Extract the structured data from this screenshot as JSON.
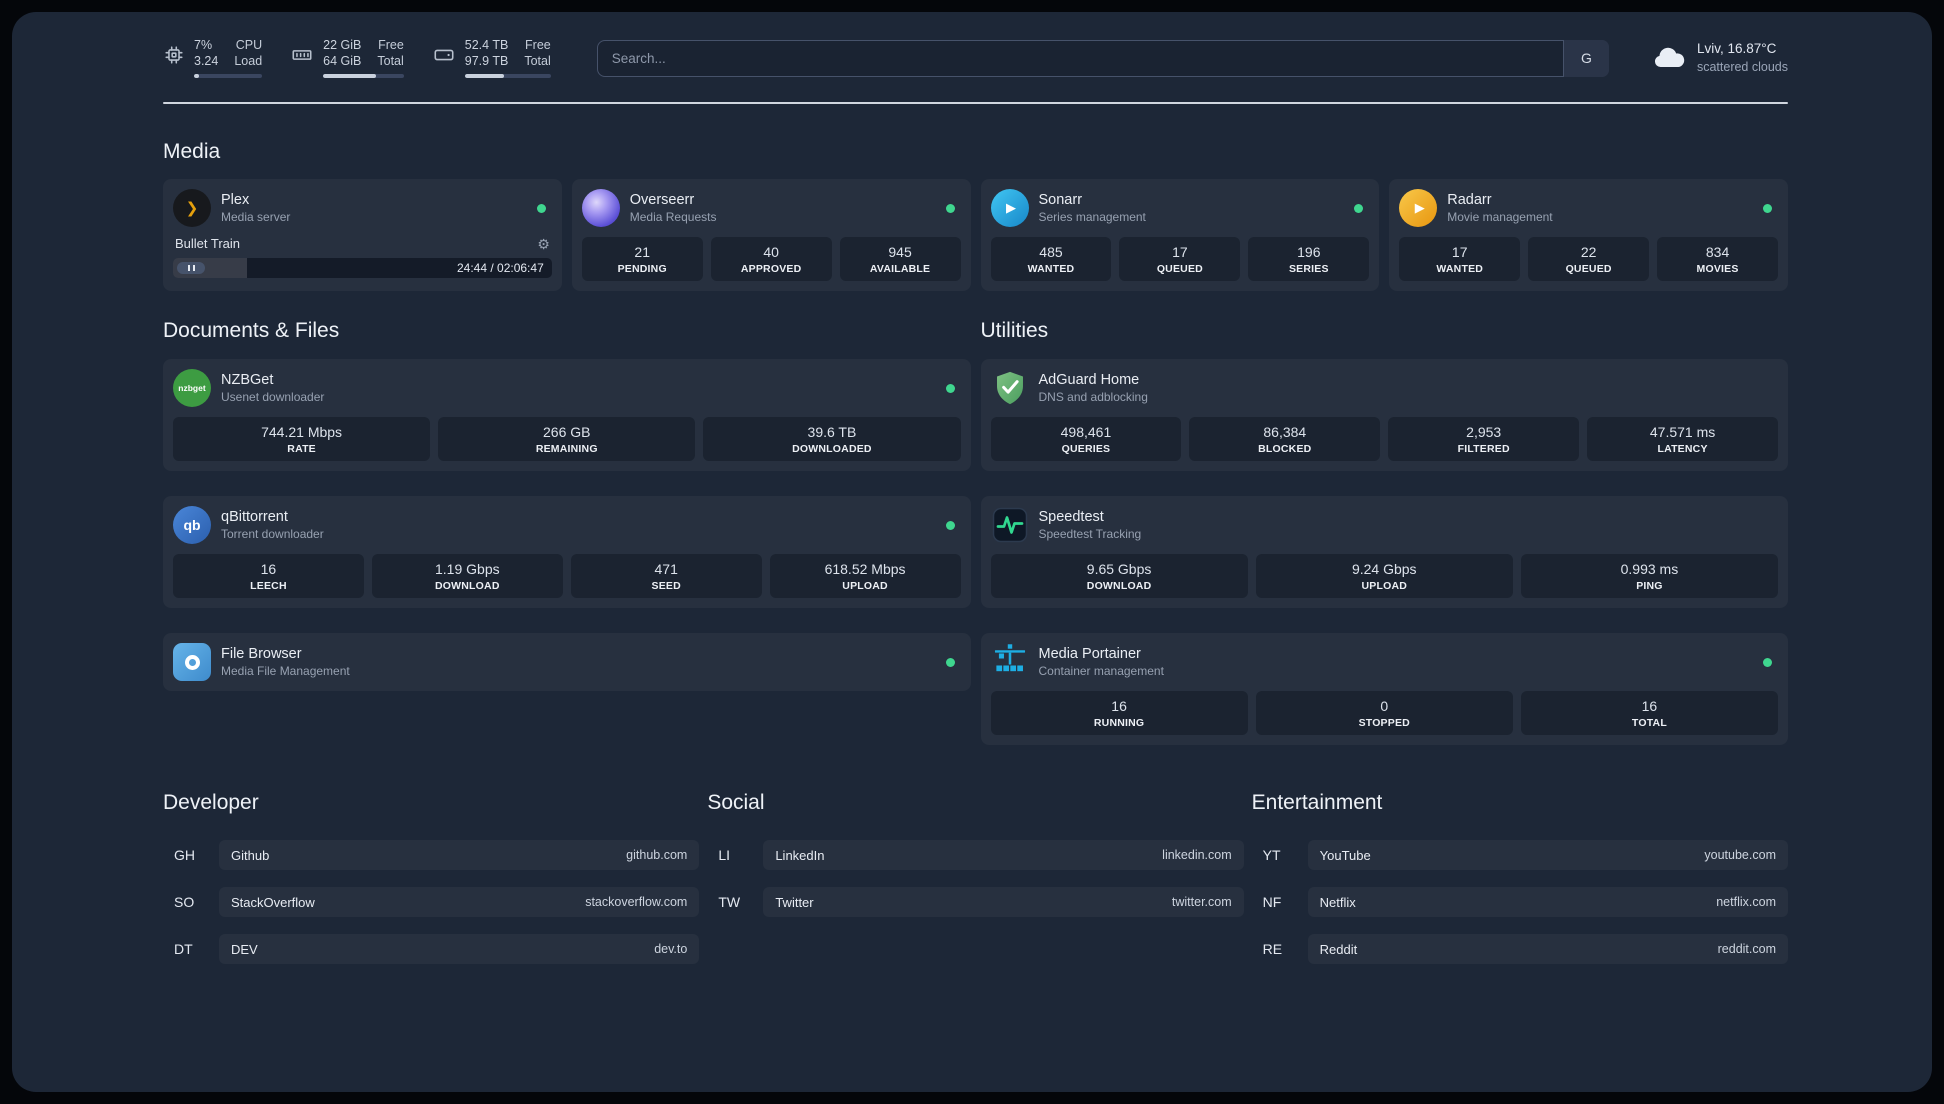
{
  "topbar": {
    "cpu": {
      "value1": "7%",
      "label1": "CPU",
      "value2": "3.24",
      "label2": "Load",
      "bar": 7
    },
    "memory": {
      "value1": "22 GiB",
      "label1": "Free",
      "value2": "64 GiB",
      "label2": "Total",
      "bar": 66
    },
    "disk": {
      "value1": "52.4 TB",
      "label1": "Free",
      "value2": "97.9 TB",
      "label2": "Total",
      "bar": 46
    },
    "search": {
      "placeholder": "Search...",
      "button": "G"
    },
    "weather": {
      "location": "Lviv, 16.87°C",
      "condition": "scattered clouds"
    }
  },
  "media": {
    "title": "Media",
    "cards": [
      {
        "name": "Plex",
        "subtitle": "Media server",
        "status": "online",
        "player": {
          "track": "Bullet Train",
          "time": "24:44 / 02:06:47",
          "progress_percent": 19.5
        }
      },
      {
        "name": "Overseerr",
        "subtitle": "Media Requests",
        "status": "online",
        "stats": [
          {
            "value": "21",
            "label": "PENDING"
          },
          {
            "value": "40",
            "label": "APPROVED"
          },
          {
            "value": "945",
            "label": "AVAILABLE"
          }
        ]
      },
      {
        "name": "Sonarr",
        "subtitle": "Series management",
        "status": "online",
        "stats": [
          {
            "value": "485",
            "label": "WANTED"
          },
          {
            "value": "17",
            "label": "QUEUED"
          },
          {
            "value": "196",
            "label": "SERIES"
          }
        ]
      },
      {
        "name": "Radarr",
        "subtitle": "Movie management",
        "status": "online",
        "stats": [
          {
            "value": "17",
            "label": "WANTED"
          },
          {
            "value": "22",
            "label": "QUEUED"
          },
          {
            "value": "834",
            "label": "MOVIES"
          }
        ]
      }
    ]
  },
  "documents": {
    "title": "Documents & Files",
    "cards": [
      {
        "name": "NZBGet",
        "subtitle": "Usenet downloader",
        "status": "online",
        "stats": [
          {
            "value": "744.21 Mbps",
            "label": "RATE"
          },
          {
            "value": "266 GB",
            "label": "REMAINING"
          },
          {
            "value": "39.6 TB",
            "label": "DOWNLOADED"
          }
        ]
      },
      {
        "name": "qBittorrent",
        "subtitle": "Torrent downloader",
        "status": "online",
        "stats": [
          {
            "value": "16",
            "label": "LEECH"
          },
          {
            "value": "1.19 Gbps",
            "label": "DOWNLOAD"
          },
          {
            "value": "471",
            "label": "SEED"
          },
          {
            "value": "618.52 Mbps",
            "label": "UPLOAD"
          }
        ]
      },
      {
        "name": "File Browser",
        "subtitle": "Media File Management",
        "status": "online"
      }
    ]
  },
  "utilities": {
    "title": "Utilities",
    "cards": [
      {
        "name": "AdGuard Home",
        "subtitle": "DNS and adblocking",
        "stats": [
          {
            "value": "498,461",
            "label": "QUERIES"
          },
          {
            "value": "86,384",
            "label": "BLOCKED"
          },
          {
            "value": "2,953",
            "label": "FILTERED"
          },
          {
            "value": "47.571 ms",
            "label": "LATENCY"
          }
        ]
      },
      {
        "name": "Speedtest",
        "subtitle": "Speedtest Tracking",
        "stats": [
          {
            "value": "9.65 Gbps",
            "label": "DOWNLOAD"
          },
          {
            "value": "9.24 Gbps",
            "label": "UPLOAD"
          },
          {
            "value": "0.993 ms",
            "label": "PING"
          }
        ]
      },
      {
        "name": "Media Portainer",
        "subtitle": "Container management",
        "status": "online",
        "stats": [
          {
            "value": "16",
            "label": "RUNNING"
          },
          {
            "value": "0",
            "label": "STOPPED"
          },
          {
            "value": "16",
            "label": "TOTAL"
          }
        ]
      }
    ]
  },
  "bookmarks": [
    {
      "title": "Developer",
      "items": [
        {
          "abbr": "GH",
          "name": "Github",
          "url": "github.com"
        },
        {
          "abbr": "SO",
          "name": "StackOverflow",
          "url": "stackoverflow.com"
        },
        {
          "abbr": "DT",
          "name": "DEV",
          "url": "dev.to"
        }
      ]
    },
    {
      "title": "Social",
      "items": [
        {
          "abbr": "LI",
          "name": "LinkedIn",
          "url": "linkedin.com"
        },
        {
          "abbr": "TW",
          "name": "Twitter",
          "url": "twitter.com"
        }
      ]
    },
    {
      "title": "Entertainment",
      "items": [
        {
          "abbr": "YT",
          "name": "YouTube",
          "url": "youtube.com"
        },
        {
          "abbr": "NF",
          "name": "Netflix",
          "url": "netflix.com"
        },
        {
          "abbr": "RE",
          "name": "Reddit",
          "url": "reddit.com"
        }
      ]
    }
  ],
  "icons": {
    "plex_glyph": "❯",
    "play_glyph": "▶",
    "gear_glyph": "⚙",
    "nzbget_text": "nzbget",
    "qbittorrent_text": "qb"
  },
  "colors": {
    "status_online": "#3fd68f",
    "plex_gold": "#e5a00d",
    "sonarr_blue": "#30b9ec",
    "radarr_amber": "#f0a41c",
    "overseerr_purple": "#5b4fd6",
    "nzbget_green": "#3d9c42",
    "qbittorrent_blue": "#3a77c9",
    "filebrowser_blue": "#4f9fdc",
    "adguard_green": "#63b06f",
    "speedtest_green": "#31d890",
    "portainer_blue": "#1daee4"
  }
}
